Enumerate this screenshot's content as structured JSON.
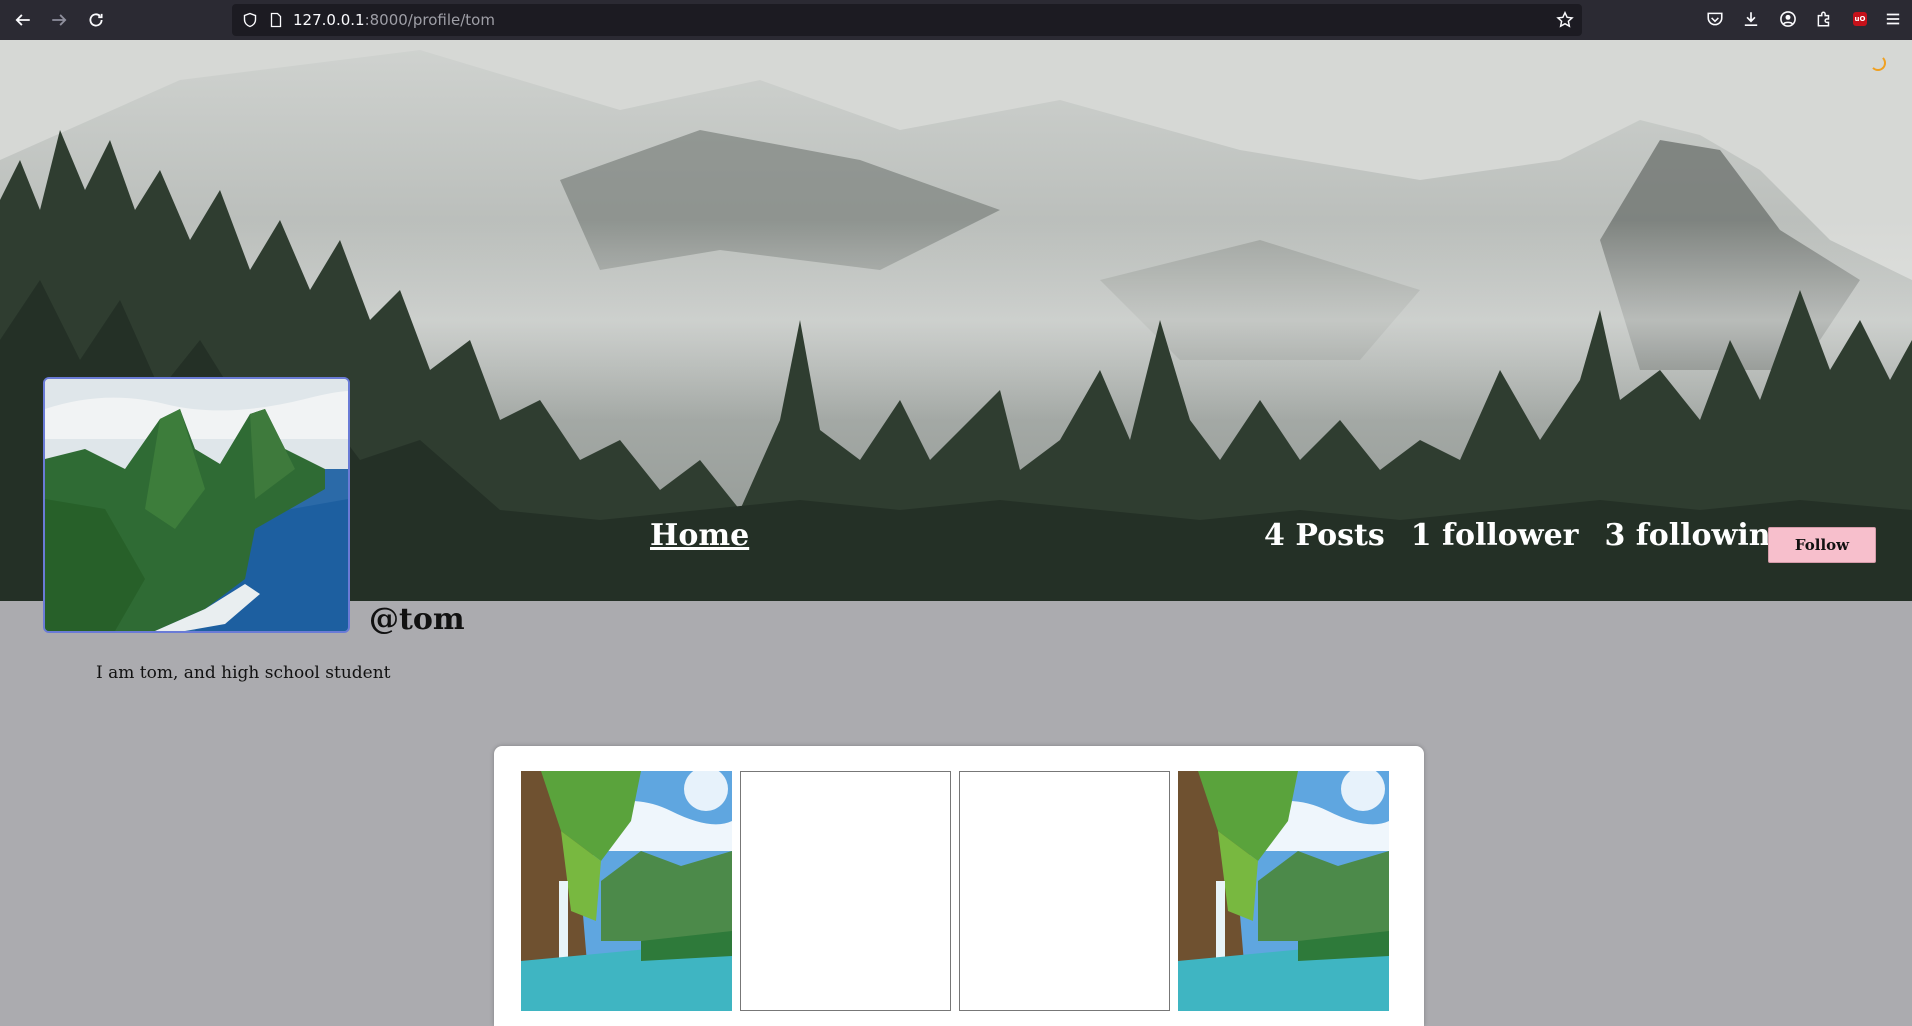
{
  "browser": {
    "url_host": "127.0.0.1",
    "url_path": ":8000/profile/tom",
    "icons": [
      "back-icon",
      "forward-icon",
      "reload-icon",
      "shield-icon",
      "page-icon",
      "star-icon",
      "pocket-icon",
      "download-icon",
      "account-icon",
      "extensions-icon",
      "ublock-icon",
      "menu-icon"
    ],
    "ublock_label": "uO"
  },
  "profile": {
    "home_label": "Home",
    "posts_count": "4 Posts",
    "followers": "1 follower",
    "following": "3 following",
    "follow_label": "Follow",
    "username": "@tom",
    "bio": "I am tom, and high school student"
  },
  "posts": [
    {
      "type": "image",
      "subject": "waterfall"
    },
    {
      "type": "blank"
    },
    {
      "type": "blank"
    },
    {
      "type": "image",
      "subject": "waterfall"
    }
  ],
  "colors": {
    "page_bg": "#ababaf",
    "follow_bg": "#f7bfcc",
    "chrome_bg": "#2b2a33",
    "load_bar": "#e6a23c"
  }
}
